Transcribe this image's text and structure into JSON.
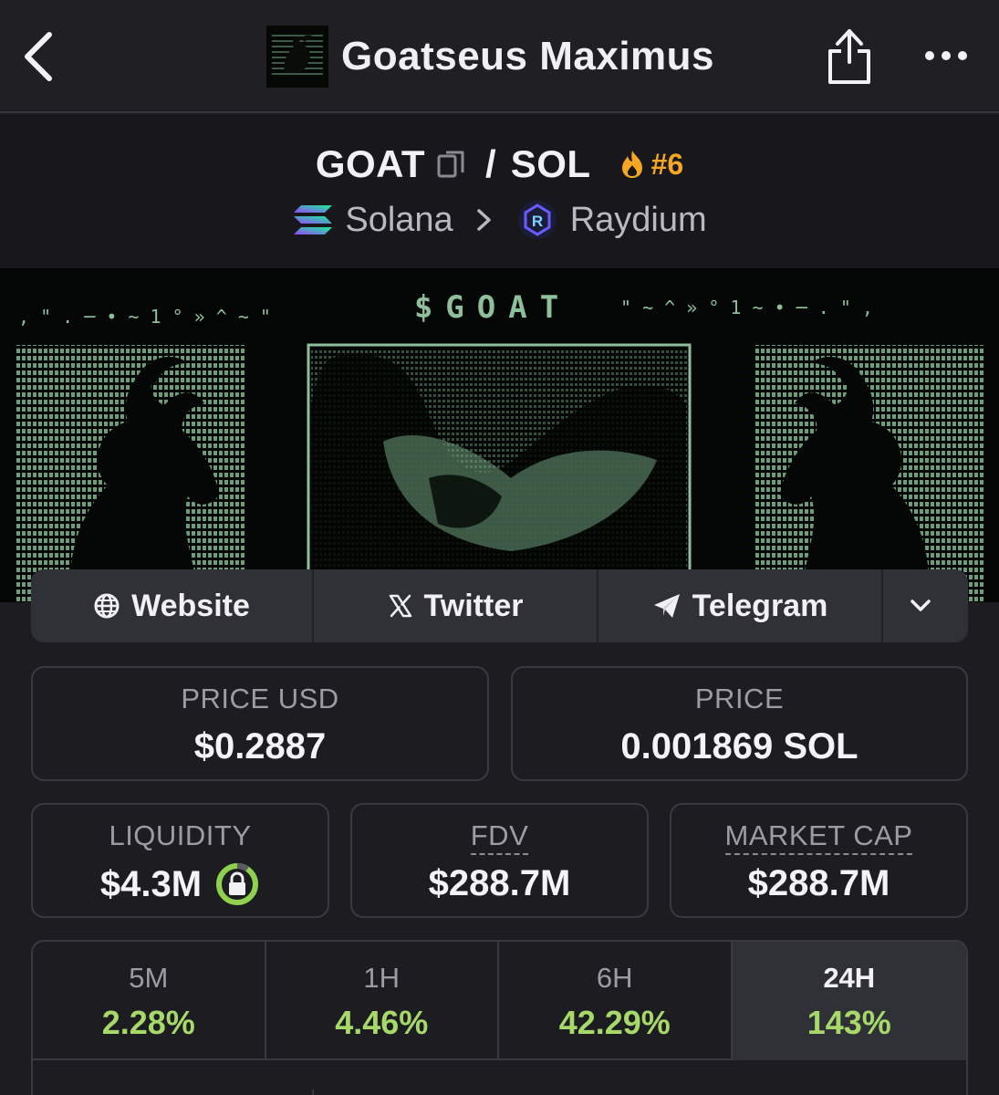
{
  "nav": {
    "title": "Goatseus Maximus",
    "back_icon": "chevron-left-icon",
    "share_icon": "share-icon",
    "more_icon": "more-dots-icon"
  },
  "pair": {
    "base": "GOAT",
    "separator": "/",
    "quote": "SOL",
    "trending_rank": "#6",
    "chain": "Solana",
    "dex": "Raydium"
  },
  "banner": {
    "ticker": "$GOAT"
  },
  "links": {
    "website": "Website",
    "twitter": "Twitter",
    "telegram": "Telegram"
  },
  "stats": {
    "price_usd": {
      "label": "PRICE USD",
      "value": "$0.2887"
    },
    "price": {
      "label": "PRICE",
      "value": "0.001869 SOL"
    },
    "liquidity": {
      "label": "LIQUIDITY",
      "value": "$4.3M"
    },
    "fdv": {
      "label": "FDV",
      "value": "$288.7M"
    },
    "market_cap": {
      "label": "MARKET CAP",
      "value": "$288.7M"
    }
  },
  "timeframes": [
    {
      "label": "5M",
      "change": "2.28%",
      "active": false
    },
    {
      "label": "1H",
      "change": "4.46%",
      "active": false
    },
    {
      "label": "6H",
      "change": "42.29%",
      "active": false
    },
    {
      "label": "24H",
      "change": "143%",
      "active": true
    }
  ],
  "colors": {
    "background": "#1c1c21",
    "positive": "#a6d96a",
    "trending": "#f5a623",
    "banner_green": "#8fbf9a"
  }
}
